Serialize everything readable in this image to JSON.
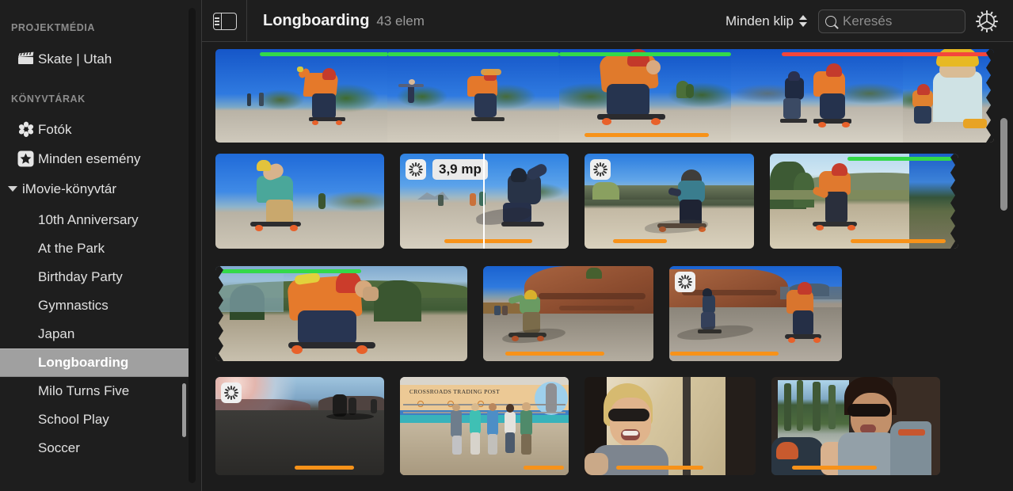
{
  "sidebar": {
    "sections": [
      {
        "title": "PROJEKTMÉDIA"
      },
      {
        "title": "KÖNYVTÁRAK"
      }
    ],
    "project_media_item": {
      "label": "Skate | Utah",
      "icon": "clapperboard-icon"
    },
    "photos_item": {
      "label": "Fotók",
      "icon": "photos-flower-icon"
    },
    "all_events_item": {
      "label": "Minden esemény",
      "icon": "star-icon"
    },
    "library_item": {
      "label": "iMovie-könyvtár",
      "icon": "disclosure-triangle-icon",
      "expanded": true
    },
    "events": [
      {
        "label": "10th Anniversary",
        "selected": false
      },
      {
        "label": "At the Park",
        "selected": false
      },
      {
        "label": "Birthday Party",
        "selected": false
      },
      {
        "label": "Gymnastics",
        "selected": false
      },
      {
        "label": "Japan",
        "selected": false
      },
      {
        "label": "Longboarding",
        "selected": true
      },
      {
        "label": "Milo Turns Five",
        "selected": false
      },
      {
        "label": "School Play",
        "selected": false
      },
      {
        "label": "Soccer",
        "selected": false
      }
    ]
  },
  "toolbar": {
    "sidebar_toggle_icon": "sidebar-toggle-icon",
    "title": "Longboarding",
    "count": "43 elem",
    "filter_label": "Minden klip",
    "filter_stepper_icon": "up-down-stepper-icon",
    "search_placeholder": "Keresés",
    "search_value": "",
    "search_icon": "search-icon",
    "settings_icon": "gear-icon"
  },
  "browser": {
    "duration_badge": "3,9 mp",
    "colors": {
      "favorite": "#33d94a",
      "rejected": "#f4463c",
      "used": "#f79219",
      "background": "#1c1c1c",
      "selection": "#a0a0a0"
    },
    "rows": [
      {
        "name": "filmstrip-row-1",
        "clips": [
          {
            "name": "clip-skater-red-helmet-crouch",
            "bars": [
              "favorite"
            ]
          },
          {
            "name": "clip-two-skaters-road",
            "bars": [
              "favorite"
            ]
          },
          {
            "name": "clip-orange-shirt-skater-closeup",
            "bars": [
              "favorite",
              "used"
            ]
          },
          {
            "name": "clip-two-skaters-downhill",
            "bars": [
              "rejected"
            ]
          },
          {
            "name": "clip-yellow-helmet-boy",
            "bars": [
              "rejected"
            ]
          }
        ]
      },
      {
        "name": "filmstrip-row-2",
        "clips": [
          {
            "name": "clip-skater-teal-shirt-arms-up",
            "bars": []
          },
          {
            "name": "clip-skater-analyzing-with-duration",
            "bars": [
              "used"
            ],
            "badges": [
              "analyzing",
              "duration"
            ],
            "playhead": true
          },
          {
            "name": "clip-woman-skater-mesa",
            "bars": [
              "used"
            ],
            "badges": [
              "analyzing"
            ]
          },
          {
            "name": "clip-skater-hills-bowing",
            "bars": [
              "favorite",
              "used"
            ]
          }
        ]
      },
      {
        "name": "filmstrip-row-3",
        "clips": [
          {
            "name": "clip-orange-shirt-skater-carving",
            "bars": [
              "favorite"
            ]
          },
          {
            "name": "clip-red-rock-cliff-skater",
            "bars": [
              "used"
            ]
          },
          {
            "name": "clip-two-skaters-red-rock",
            "bars": [
              "used"
            ],
            "badges": [
              "analyzing"
            ]
          }
        ]
      },
      {
        "name": "filmstrip-row-4",
        "clips": [
          {
            "name": "clip-sunset-road-silhouette",
            "bars": [
              "used"
            ],
            "badges": [
              "analyzing"
            ]
          },
          {
            "name": "clip-crossroads-trading-post-group",
            "bars": [
              "used"
            ]
          },
          {
            "name": "clip-blond-man-in-van",
            "bars": [
              "used"
            ]
          },
          {
            "name": "clip-woman-in-van",
            "bars": [
              "used"
            ]
          }
        ]
      }
    ]
  }
}
